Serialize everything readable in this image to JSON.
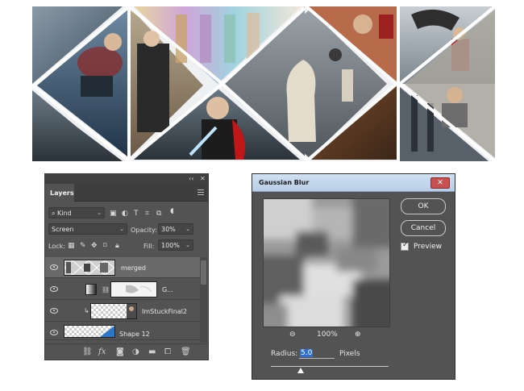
{
  "layers_panel": {
    "tab_label": "Layers",
    "filter_kind": "Kind",
    "blend_mode": "Screen",
    "opacity_label": "Opacity:",
    "opacity_value": "30%",
    "lock_label": "Lock:",
    "fill_label": "Fill:",
    "fill_value": "100%",
    "layers": [
      {
        "name": "merged",
        "selected": true
      },
      {
        "name": "G...",
        "selected": false
      },
      {
        "name": "ImStuckFinal2",
        "selected": false
      },
      {
        "name": "Shape 12",
        "selected": false
      }
    ]
  },
  "gaussian_blur": {
    "title": "Gaussian Blur",
    "ok_label": "OK",
    "cancel_label": "Cancel",
    "preview_label": "Preview",
    "preview_checked": true,
    "zoom": "100%",
    "radius_label": "Radius:",
    "radius_value": "5.0",
    "units": "Pixels",
    "radius_slider_fraction": 0.25
  },
  "colors": {
    "panel_bg": "#535353",
    "selected_row": "#6a6a6a",
    "highlight": "#2f6fd1",
    "close_button": "#c75050"
  }
}
